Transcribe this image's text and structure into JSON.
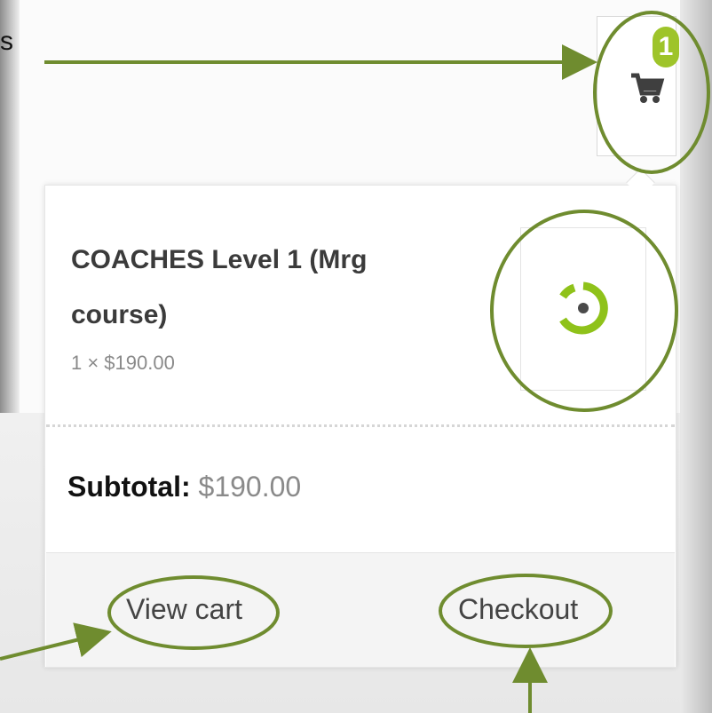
{
  "header": {
    "cut_text": "s",
    "cart_count": "1",
    "cart_icon": "cart-icon"
  },
  "mini_cart": {
    "item": {
      "name": "COACHES Level 1 (Mrg course)",
      "meta": "1 × $190.00",
      "thumbnail_icon": "logo-ring-icon"
    },
    "subtotal_label": "Subtotal:",
    "subtotal_amount": "$190.00",
    "view_cart_label": "View cart",
    "checkout_label": "Checkout"
  },
  "colors": {
    "accent_green": "#9ec42a",
    "annotation_green": "#6f8c2f",
    "text_dark": "#3b3b3b",
    "text_muted": "#8a8a8a"
  }
}
